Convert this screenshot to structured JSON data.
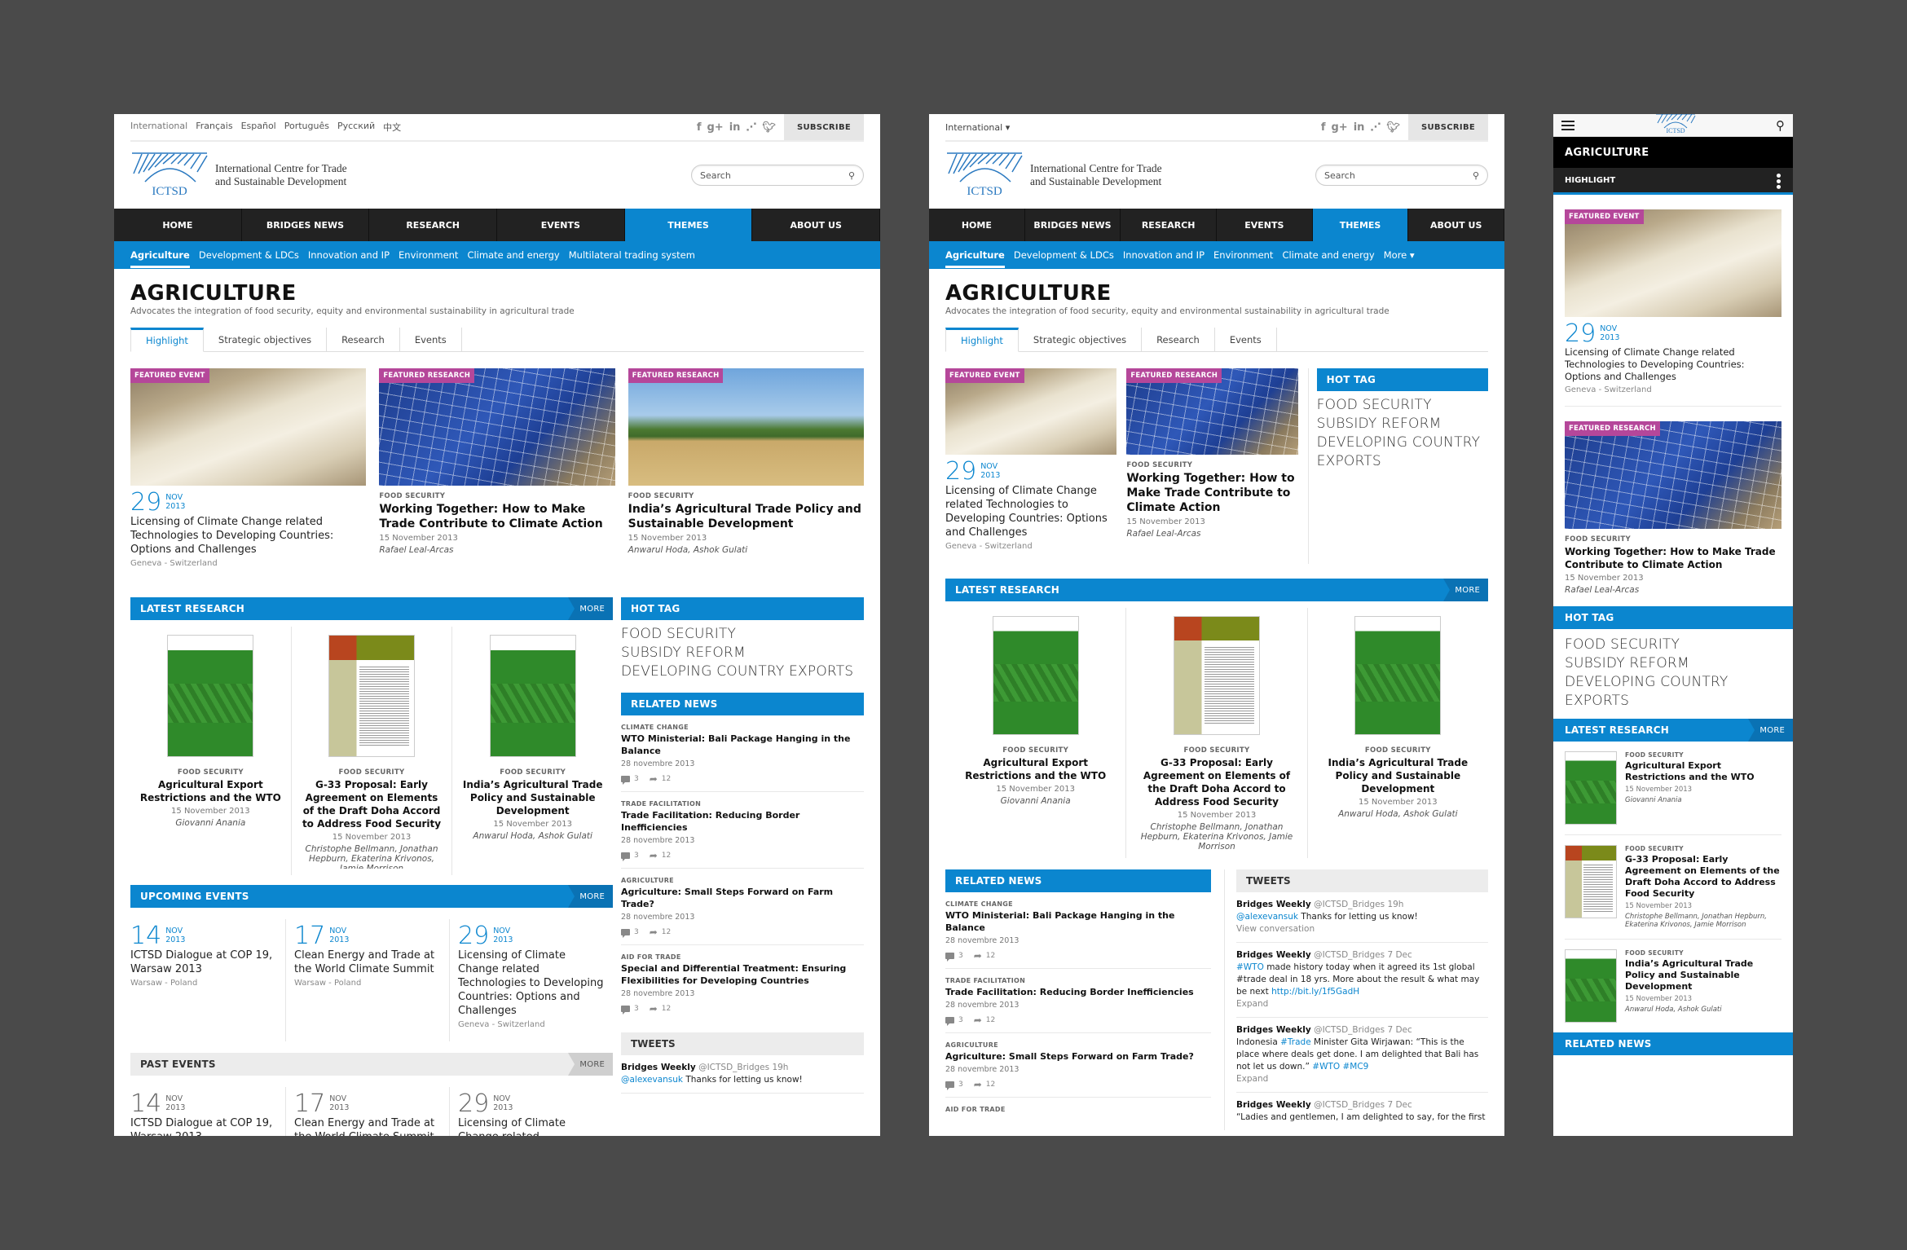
{
  "colors": {
    "accent": "#0b86cf",
    "badge": "#b5479a",
    "nav_bg": "#222222",
    "page_bg": "#4a4a4a"
  },
  "common": {
    "languages": [
      "International",
      "Français",
      "Español",
      "Português",
      "Русский",
      "中文"
    ],
    "language_dropdown": "International ▾",
    "social_icons": [
      "facebook-icon",
      "google-plus-icon",
      "linkedin-icon",
      "rss-icon",
      "twitter-icon"
    ],
    "subscribe": "SUBSCRIBE",
    "logo_abbr": "ICTSD",
    "logo_line1": "International Centre for Trade",
    "logo_line2": "and Sustainable Development",
    "search_placeholder": "Search",
    "main_nav": [
      "HOME",
      "BRIDGES NEWS",
      "RESEARCH",
      "EVENTS",
      "THEMES",
      "ABOUT US"
    ],
    "main_nav_active": "THEMES",
    "sub_nav_desktop": [
      "Agriculture",
      "Development & LDCs",
      "Innovation and IP",
      "Environment",
      "Climate and energy",
      "Multilateral trading system"
    ],
    "sub_nav_tablet": [
      "Agriculture",
      "Development & LDCs",
      "Innovation and IP",
      "Environment",
      "Climate and energy",
      "More ▾"
    ],
    "page_title": "AGRICULTURE",
    "page_desc": "Advocates the integration of food security, equity and environmental sustainability in agricultural trade",
    "tabs": [
      "Highlight",
      "Strategic objectives",
      "Research",
      "Events"
    ],
    "mobile_section": "HIGHLIGHT"
  },
  "featured": [
    {
      "badge": "FEATURED EVENT",
      "day": "29",
      "month": "NOV",
      "year": "2013",
      "title": "Licensing of Climate Change related Technologies to Developing Countries: Options and Challenges",
      "location": "Geneva - Switzerland"
    },
    {
      "badge": "FEATURED RESEARCH",
      "category": "FOOD SECURITY",
      "title": "Working Together: How to Make Trade Contribute to Climate Action",
      "date": "15 November 2013",
      "author": "Rafael Leal-Arcas"
    },
    {
      "badge": "FEATURED RESEARCH",
      "category": "FOOD SECURITY",
      "title": "India’s Agricultural Trade Policy and Sustainable Development",
      "date": "15 November 2013",
      "author": "Anwarul Hoda, Ashok Gulati"
    }
  ],
  "sections": {
    "latest_research": "LATEST RESEARCH",
    "upcoming_events": "UPCOMING EVENTS",
    "past_events": "PAST EVENTS",
    "hot_tag": "HOT TAG",
    "related_news": "RELATED NEWS",
    "tweets": "TWEETS",
    "more": "MORE"
  },
  "research": [
    {
      "category": "FOOD SECURITY",
      "title": "Agricultural Export Restrictions and the WTO",
      "date": "15 November 2013",
      "author": "Giovanni Anania"
    },
    {
      "category": "FOOD SECURITY",
      "title": "G-33 Proposal: Early Agreement on Elements of the Draft Doha Accord to Address Food Security",
      "date": "15 November 2013",
      "author": "Christophe Bellmann, Jonathan Hepburn, Ekaterina Krivonos, Jamie Morrison"
    },
    {
      "category": "FOOD SECURITY",
      "title": "India’s Agricultural Trade Policy and Sustainable Development",
      "date": "15 November 2013",
      "author": "Anwarul Hoda, Ashok Gulati"
    }
  ],
  "hot_tags": [
    "FOOD SECURITY",
    "SUBSIDY REFORM",
    "DEVELOPING COUNTRY EXPORTS"
  ],
  "events": [
    {
      "day": "14",
      "month": "NOV",
      "year": "2013",
      "title": "ICTSD Dialogue at COP 19, Warsaw 2013",
      "location": "Warsaw - Poland"
    },
    {
      "day": "17",
      "month": "NOV",
      "year": "2013",
      "title": "Clean Energy and Trade at the World Climate Summit",
      "location": "Warsaw - Poland"
    },
    {
      "day": "29",
      "month": "NOV",
      "year": "2013",
      "title": "Licensing of Climate Change related Technologies to Developing Countries: Options and Challenges",
      "location": "Geneva - Switzerland"
    }
  ],
  "news": [
    {
      "category": "CLIMATE CHANGE",
      "title": "WTO Ministerial: Bali Package Hanging in the Balance",
      "date": "28 novembre 2013",
      "comments": "3",
      "shares": "12"
    },
    {
      "category": "TRADE FACILITATION",
      "title": "Trade Facilitation: Reducing Border Inefficiencies",
      "date": "28 novembre 2013",
      "comments": "3",
      "shares": "12"
    },
    {
      "category": "AGRICULTURE",
      "title": "Agriculture: Small Steps Forward on Farm Trade?",
      "date": "28 novembre 2013",
      "comments": "3",
      "shares": "12"
    },
    {
      "category": "AID FOR TRADE",
      "title": "Special and Differential Treatment: Ensuring Flexibilities for Developing Countries",
      "date": "28 novembre 2013",
      "comments": "3",
      "shares": "12"
    }
  ],
  "tweets": [
    {
      "name": "Bridges Weekly",
      "handle": "@ICTSD_Bridges 19h",
      "link1": "@alexevansuk",
      "text": " Thanks for letting us know!",
      "action": "View conversation"
    },
    {
      "name": "Bridges Weekly",
      "handle": "@ICTSD_Bridges 7 Dec",
      "link1": "#WTO",
      "text": " made history today when it agreed its 1st global #trade deal in 18 yrs. More about the result & what may be next ",
      "link2": "http://bit.ly/1f5GadH",
      "action": "Expand"
    },
    {
      "name": "Bridges Weekly",
      "handle": "@ICTSD_Bridges 7 Dec",
      "pre": "Indonesia ",
      "link1": "#Trade",
      "text": " Minister Gita Wirjawan: “This is the place where deals get done. I am delighted that Bali has not let us down.” ",
      "link2": "#WTO #MC9",
      "action": "Expand"
    },
    {
      "name": "Bridges Weekly",
      "handle": "@ICTSD_Bridges 7 Dec",
      "text": "“Ladies and gentlemen, I am delighted to say, for the first"
    }
  ]
}
